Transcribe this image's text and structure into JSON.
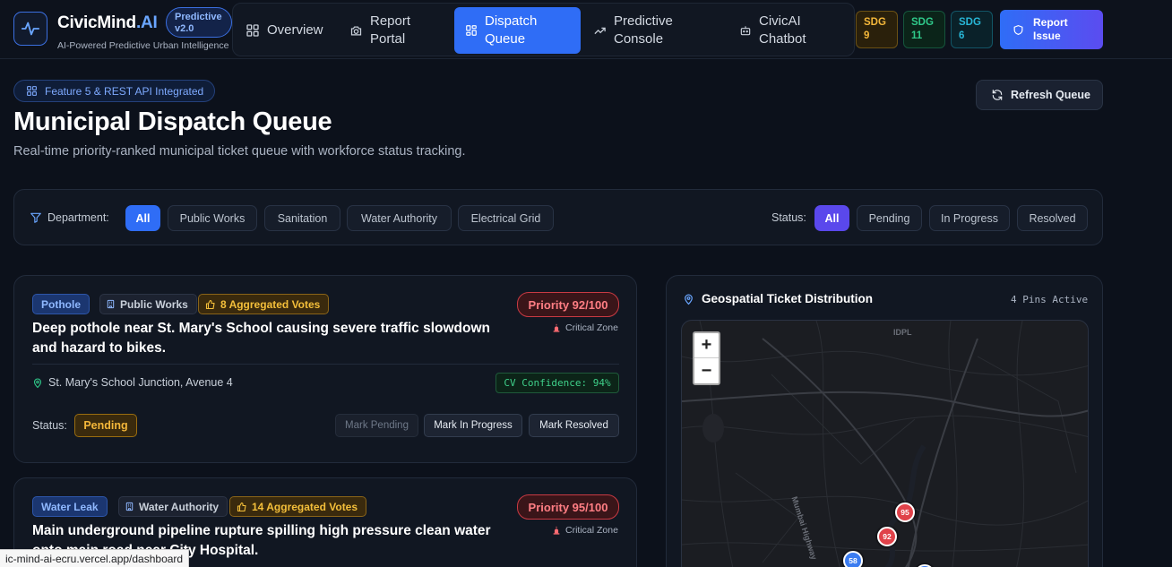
{
  "app": {
    "brand_main": "CivicMind",
    "brand_accent": ".AI",
    "brand_sub": "AI-Powered Predictive Urban Intelligence",
    "version_line1": "Predictive",
    "version_line2": "v2.0"
  },
  "nav": {
    "items": [
      {
        "line1": "Overview",
        "line2": "",
        "icon": "grid-icon"
      },
      {
        "line1": "Report",
        "line2": "Portal",
        "icon": "camera-icon"
      },
      {
        "line1": "Dispatch",
        "line2": "Queue",
        "icon": "dashboard-icon",
        "active": true
      },
      {
        "line1": "Predictive",
        "line2": "Console",
        "icon": "trend-up-icon"
      },
      {
        "line1": "CivicAI",
        "line2": "Chatbot",
        "icon": "bot-icon"
      }
    ]
  },
  "sdg": [
    {
      "line1": "SDG",
      "line2": "9",
      "color": "#f4b73a"
    },
    {
      "line1": "SDG",
      "line2": "11",
      "color": "#2fc98a"
    },
    {
      "line1": "SDG",
      "line2": "6",
      "color": "#28b6d6"
    }
  ],
  "report_issue": {
    "line1": "Report",
    "line2": "Issue"
  },
  "page": {
    "feature_pill": "Feature 5 & REST API Integrated",
    "title": "Municipal Dispatch Queue",
    "subtitle": "Real-time priority-ranked municipal ticket queue with workforce status tracking.",
    "refresh_label": "Refresh Queue"
  },
  "filters": {
    "department_label": "Department:",
    "departments": [
      "All",
      "Public Works",
      "Sanitation",
      "Water Authority",
      "Electrical Grid"
    ],
    "status_label": "Status:",
    "statuses": [
      "All",
      "Pending",
      "In Progress",
      "Resolved"
    ]
  },
  "tickets": [
    {
      "type": "Pothole",
      "department": "Public Works",
      "votes": "8 Aggregated Votes",
      "title": "Deep pothole near St. Mary's School causing severe traffic slowdown and hazard to bikes.",
      "priority": "Priority 92/100",
      "zone": "Critical Zone",
      "location": "St. Mary's School Junction, Avenue 4",
      "cv": "CV Confidence: 94%",
      "status_label": "Status:",
      "status": "Pending",
      "actions": [
        "Mark Pending",
        "Mark In Progress",
        "Mark Resolved"
      ]
    },
    {
      "type": "Water Leak",
      "department": "Water Authority",
      "votes": "14 Aggregated Votes",
      "title": "Main underground pipeline rupture spilling high pressure clean water onto main road near City Hospital.",
      "priority": "Priority 95/100",
      "zone": "Critical Zone"
    }
  ],
  "map": {
    "title": "Geospatial Ticket Distribution",
    "pins_active": "4 Pins Active",
    "zoom_in": "+",
    "zoom_out": "−",
    "labels": [
      "IDPL",
      "Mumbai Highway"
    ],
    "pins": [
      {
        "label": "95",
        "color": "#e0424a"
      },
      {
        "label": "92",
        "color": "#e0424a"
      },
      {
        "label": "58",
        "color": "#3b7cf0"
      },
      {
        "label": "",
        "color": "#3b7cf0"
      }
    ]
  },
  "browser_status": "ic-mind-ai-ecru.vercel.app/dashboard"
}
